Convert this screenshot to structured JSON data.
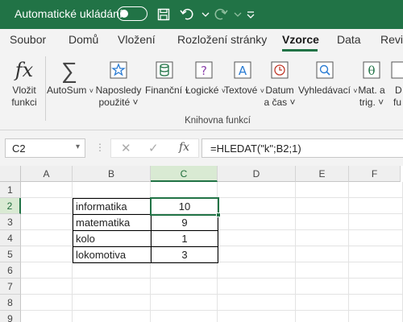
{
  "titlebar": {
    "autosave_label": "Automatické ukládání",
    "icons": [
      "save-icon",
      "undo-icon",
      "redo-icon",
      "customize-quick-access-icon"
    ]
  },
  "tabs": [
    {
      "label": "Soubor"
    },
    {
      "label": "Domů"
    },
    {
      "label": "Vložení"
    },
    {
      "label": "Rozložení stránky"
    },
    {
      "label": "Vzorce",
      "active": true
    },
    {
      "label": "Data"
    },
    {
      "label": "Revize"
    }
  ],
  "ribbon": {
    "buttons": [
      {
        "l1": "Vložit",
        "l2": "funkci",
        "icon": "fx-icon"
      },
      {
        "l1": "AutoSum",
        "l2": "",
        "icon": "sum-icon"
      },
      {
        "l1": "Naposledy",
        "l2": "použité ˅",
        "icon": "star-icon"
      },
      {
        "l1": "Finanční",
        "l2": "",
        "icon": "database-icon"
      },
      {
        "l1": "Logické",
        "l2": "",
        "icon": "question-icon"
      },
      {
        "l1": "Textové",
        "l2": "",
        "icon": "text-icon"
      },
      {
        "l1": "Datum",
        "l2": "a čas ˅",
        "icon": "clock-icon"
      },
      {
        "l1": "Vyhledávací",
        "l2": "",
        "icon": "search-icon"
      },
      {
        "l1": "Mat. a",
        "l2": "trig. ˅",
        "icon": "theta-icon"
      },
      {
        "l1": "D",
        "l2": "fu",
        "icon": "more-functions-icon"
      }
    ],
    "group_label": "Knihovna funkcí"
  },
  "formula_bar": {
    "name_box": "C2",
    "formula": "=HLEDAT(\"k\";B2;1)"
  },
  "grid": {
    "columns": [
      "A",
      "B",
      "C",
      "D",
      "E",
      "F"
    ],
    "rows": [
      "1",
      "2",
      "3",
      "4",
      "5",
      "6",
      "7",
      "8",
      "9"
    ],
    "selected_cell": "C2",
    "data": [
      {
        "b": "informatika",
        "c": "10"
      },
      {
        "b": "matematika",
        "c": "9"
      },
      {
        "b": "kolo",
        "c": "1"
      },
      {
        "b": "lokomotiva",
        "c": "3"
      }
    ]
  },
  "colors": {
    "accent": "#217346",
    "ribbon_bg": "#f3f3f3"
  }
}
